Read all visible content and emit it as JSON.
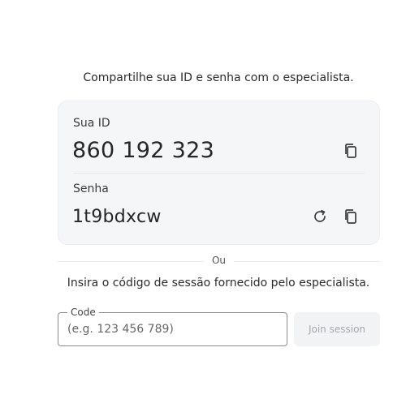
{
  "share_instruction": "Compartilhe sua ID e senha com o especialista.",
  "credentials": {
    "id_label": "Sua ID",
    "id_value": "860 192 323",
    "password_label": "Senha",
    "password_value": "1t9bdxcw"
  },
  "icons": {
    "copy_id": "copy-icon",
    "refresh_password": "refresh-icon",
    "copy_password": "copy-icon"
  },
  "separator_text": "Ou",
  "session_instruction": "Insira o código de sessão fornecido pelo especialista.",
  "code_field": {
    "label": "Code",
    "value": "",
    "placeholder": "(e.g. 123 456 789)"
  },
  "join_button": {
    "label": "Join session",
    "enabled": false
  },
  "colors": {
    "card_background": "#f5f6f8",
    "button_disabled_background": "#f2f3f5",
    "button_disabled_text": "#a5a8ad",
    "icon": "#3c3c3c"
  }
}
